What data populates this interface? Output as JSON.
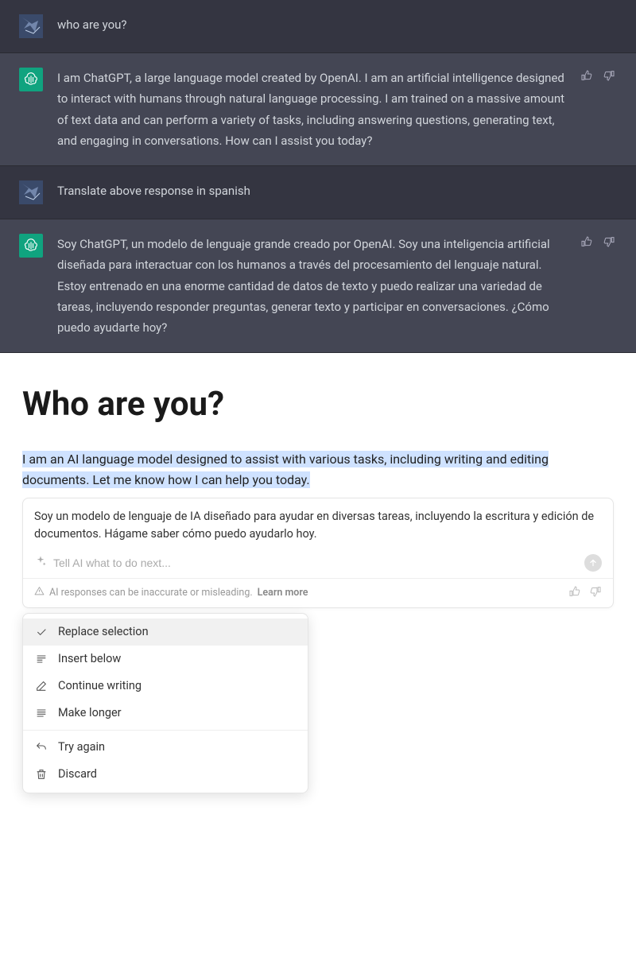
{
  "chat": {
    "messages": [
      {
        "role": "user",
        "text": "who are you?"
      },
      {
        "role": "assistant",
        "text": "I am ChatGPT, a large language model created by OpenAI. I am an artificial intelligence designed to interact with humans through natural language processing. I am trained on a massive amount of text data and can perform a variety of tasks, including answering questions, generating text, and engaging in conversations. How can I assist you today?"
      },
      {
        "role": "user",
        "text": "Translate above response in spanish"
      },
      {
        "role": "assistant",
        "text": "Soy ChatGPT, un modelo de lenguaje grande creado por OpenAI. Soy una inteligencia artificial diseñada para interactuar con los humanos a través del procesamiento del lenguaje natural. Estoy entrenado en una enorme cantidad de datos de texto y puedo realizar una variedad de tareas, incluyendo responder preguntas, generar texto y participar en conversaciones. ¿Cómo puedo ayudarte hoy?"
      }
    ]
  },
  "doc": {
    "title": "Who are you?",
    "highlighted_text": "I am an AI language model designed to assist with various tasks, including writing and editing documents. Let me know how I can help you today."
  },
  "ai_panel": {
    "response": "Soy un modelo de lenguaje de IA diseñado para ayudar en diversas tareas, incluyendo la escritura y edición de documentos. Hágame saber cómo puedo ayudarlo hoy.",
    "placeholder": "Tell AI what to do next...",
    "disclaimer": "AI responses can be inaccurate or misleading.",
    "learn_more": "Learn more"
  },
  "ctx_menu": {
    "items": {
      "replace": "Replace selection",
      "insert_below": "Insert below",
      "continue": "Continue writing",
      "longer": "Make longer",
      "try_again": "Try again",
      "discard": "Discard"
    }
  }
}
